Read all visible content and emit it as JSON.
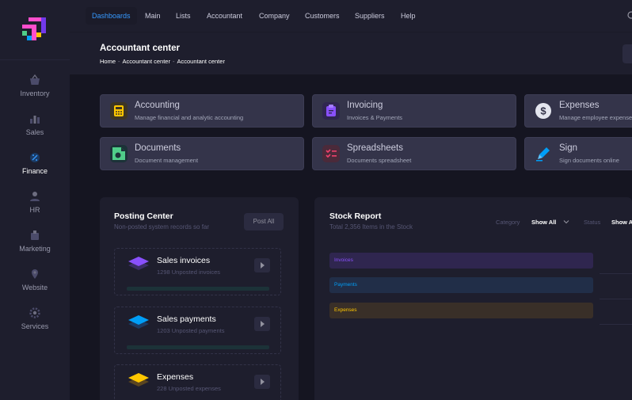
{
  "topnav": {
    "items": [
      "Dashboards",
      "Main",
      "Lists",
      "Accountant",
      "Company",
      "Customers",
      "Suppliers",
      "Help"
    ]
  },
  "sidebar": {
    "items": [
      {
        "label": "Inventory",
        "icon": "basket-icon"
      },
      {
        "label": "Sales",
        "icon": "chart-icon"
      },
      {
        "label": "Finance",
        "icon": "finance-icon"
      },
      {
        "label": "HR",
        "icon": "people-icon"
      },
      {
        "label": "Marketing",
        "icon": "marketing-icon"
      },
      {
        "label": "Website",
        "icon": "website-icon"
      },
      {
        "label": "Services",
        "icon": "gear-icon"
      }
    ]
  },
  "header": {
    "title": "Accountant center",
    "breadcrumb": [
      "Home",
      "Accountant center",
      "Accountant center"
    ]
  },
  "cards": [
    {
      "title": "Accounting",
      "desc": "Manage financial and analytic accounting",
      "icon": "calculator-icon",
      "color": "#ffc700"
    },
    {
      "title": "Invoicing",
      "desc": "Invoices & Payments",
      "icon": "clipboard-icon",
      "color": "#8950fc"
    },
    {
      "title": "Expenses",
      "desc": "Manage employee expenses",
      "icon": "dollar-icon",
      "color": "#e4e6ef"
    },
    {
      "title": "Documents",
      "desc": "Document management",
      "icon": "document-icon",
      "color": "#50cd89"
    },
    {
      "title": "Spreadsheets",
      "desc": "Documents spreadsheet",
      "icon": "checklist-icon",
      "color": "#f1416c"
    },
    {
      "title": "Sign",
      "desc": "Sign documents online",
      "icon": "pen-icon",
      "color": "#009ef7"
    }
  ],
  "posting": {
    "title": "Posting Center",
    "subtitle": "Non-posted system records so far",
    "button": "Post All",
    "items": [
      {
        "title": "Sales invoices",
        "sub": "1298 Unposted invoices",
        "color": "#8950fc"
      },
      {
        "title": "Sales payments",
        "sub": "1203 Unposted payments",
        "color": "#009ef7"
      },
      {
        "title": "Expenses",
        "sub": "228 Unposted expenses",
        "color": "#ffc700"
      }
    ]
  },
  "stock": {
    "title": "Stock Report",
    "subtitle": "Total 2,356 Items in the Stock",
    "category_label": "Category",
    "category_value": "Show All",
    "status_label": "Status",
    "status_value": "Show All",
    "rows": [
      {
        "label": "Invoices",
        "color": "#8950fc",
        "bg": "#2f264f"
      },
      {
        "label": "Payments",
        "color": "#009ef7",
        "bg": "#212e48"
      },
      {
        "label": "Expenses",
        "color": "#ffc700",
        "bg": "#392f28"
      }
    ]
  }
}
